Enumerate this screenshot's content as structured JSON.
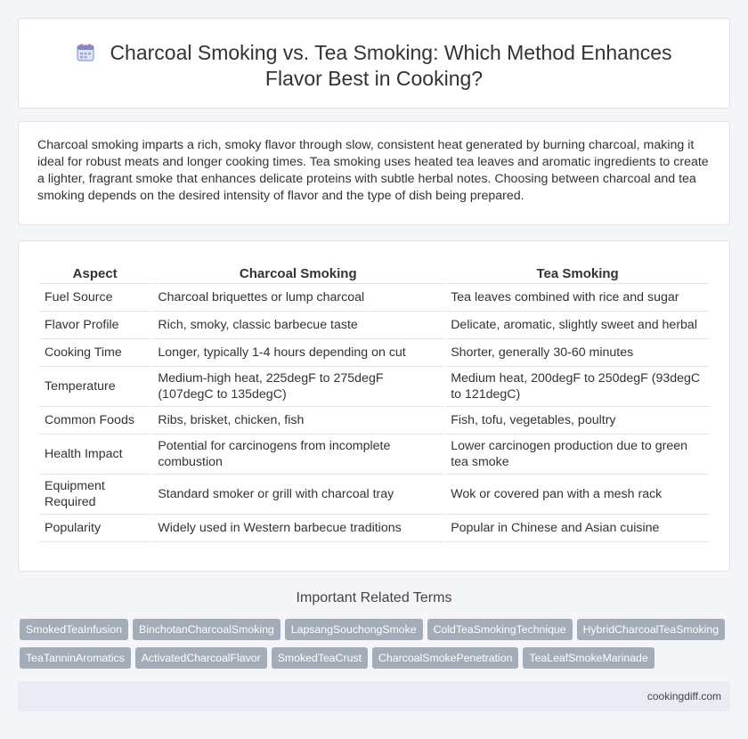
{
  "header": {
    "title": "Charcoal Smoking vs. Tea Smoking: Which Method Enhances Flavor Best in Cooking?",
    "icon": "calendar-icon"
  },
  "intro": "Charcoal smoking imparts a rich, smoky flavor through slow, consistent heat generated by burning charcoal, making it ideal for robust meats and longer cooking times. Tea smoking uses heated tea leaves and aromatic ingredients to create a lighter, fragrant smoke that enhances delicate proteins with subtle herbal notes. Choosing between charcoal and tea smoking depends on the desired intensity of flavor and the type of dish being prepared.",
  "table": {
    "headers": [
      "Aspect",
      "Charcoal Smoking",
      "Tea Smoking"
    ],
    "rows": [
      [
        "Fuel Source",
        "Charcoal briquettes or lump charcoal",
        "Tea leaves combined with rice and sugar"
      ],
      [
        "Flavor Profile",
        "Rich, smoky, classic barbecue taste",
        "Delicate, aromatic, slightly sweet and herbal"
      ],
      [
        "Cooking Time",
        "Longer, typically 1-4 hours depending on cut",
        "Shorter, generally 30-60 minutes"
      ],
      [
        "Temperature",
        "Medium-high heat, 225degF to 275degF (107degC to 135degC)",
        "Medium heat, 200degF to 250degF (93degC to 121degC)"
      ],
      [
        "Common Foods",
        "Ribs, brisket, chicken, fish",
        "Fish, tofu, vegetables, poultry"
      ],
      [
        "Health Impact",
        "Potential for carcinogens from incomplete combustion",
        "Lower carcinogen production due to green tea smoke"
      ],
      [
        "Equipment Required",
        "Standard smoker or grill with charcoal tray",
        "Wok or covered pan with a mesh rack"
      ],
      [
        "Popularity",
        "Widely used in Western barbecue traditions",
        "Popular in Chinese and Asian cuisine"
      ]
    ]
  },
  "related": {
    "title": "Important Related Terms",
    "tags": [
      "SmokedTeaInfusion",
      "BinchotanCharcoalSmoking",
      "LapsangSouchongSmoke",
      "ColdTeaSmokingTechnique",
      "HybridCharcoalTeaSmoking",
      "TeaTanninAromatics",
      "ActivatedCharcoalFlavor",
      "SmokedTeaCrust",
      "CharcoalSmokePenetration",
      "TeaLeafSmokeMarinade"
    ]
  },
  "footer": {
    "site": "cookingdiff.com"
  }
}
